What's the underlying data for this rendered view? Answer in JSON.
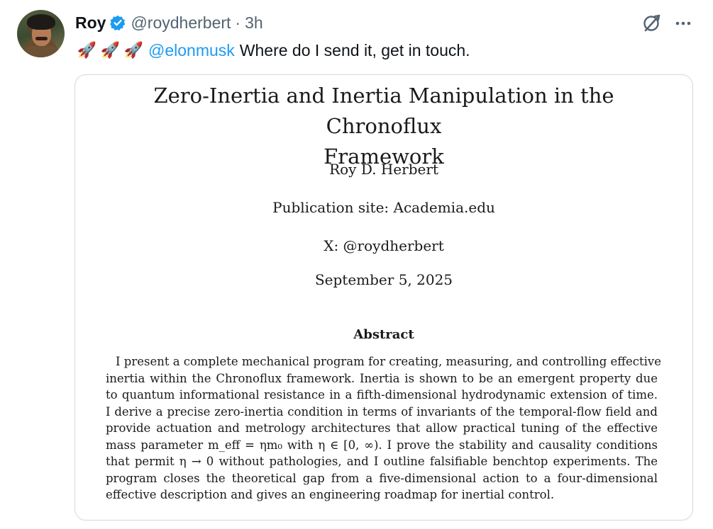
{
  "tweet": {
    "author_name": "Roy",
    "handle": "@roydherbert",
    "separator": "·",
    "time": "3h",
    "rocket_emojis": [
      "🚀",
      "🚀",
      "🚀"
    ],
    "mention": "@elonmusk",
    "text": "Where do I send it, get in touch.",
    "verified_color": "#1d9bf0"
  },
  "paper": {
    "title_line1": "Zero-Inertia and Inertia Manipulation in the Chronoflux",
    "title_line2": "Framework",
    "author": "Roy D. Herbert",
    "publication_site": "Publication site: Academia.edu",
    "x_handle": "X: @roydherbert",
    "date": "September 5, 2025",
    "abstract_heading": "Abstract",
    "abstract_lines": [
      "I present a complete mechanical program for creating, measuring, and controlling effective",
      "inertia within the Chronoflux framework. Inertia is shown to be an emergent property due",
      "to quantum informational resistance in a fifth-dimensional hydrodynamic extension of time.",
      "I derive a precise zero-inertia condition in terms of invariants of the temporal-flow field and",
      "provide actuation and metrology architectures that allow practical tuning of the effective",
      "mass parameter m_eff = ηm₀ with η ∈ [0, ∞). I prove the stability and causality conditions",
      "that permit η → 0 without pathologies, and I outline falsifiable benchtop experiments. The",
      "program closes the theoretical gap from a five-dimensional action to a four-dimensional",
      "effective description and gives an engineering roadmap for inertial control."
    ]
  },
  "icons": {
    "avatar": "avatar",
    "verified": "verified-badge-icon",
    "grok": "grok-icon",
    "more": "more-options-icon"
  }
}
